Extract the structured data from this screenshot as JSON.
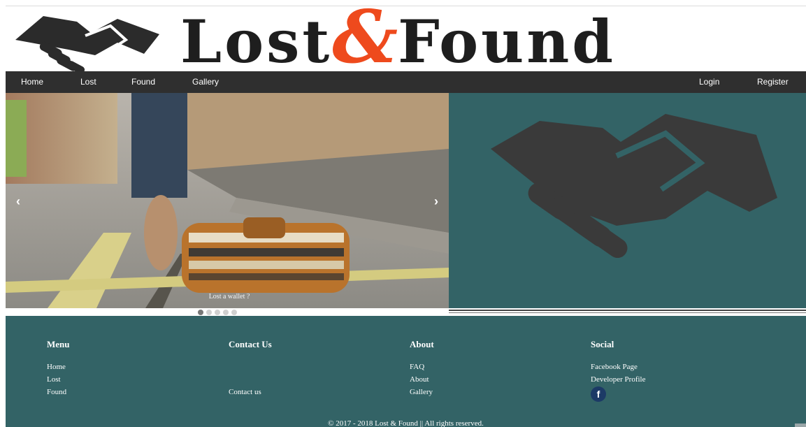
{
  "brand": {
    "word1": "Lost",
    "ampersand": "&",
    "word2": "Found",
    "colors": {
      "dark": "#1e1e1e",
      "accent": "#ee4a1d",
      "teal": "#336366",
      "nav": "#2f2f2f"
    },
    "logo_icon": "handshake-icon"
  },
  "nav": {
    "left": [
      "Home",
      "Lost",
      "Found",
      "Gallery"
    ],
    "right": [
      "Login",
      "Register"
    ]
  },
  "carousel": {
    "prev_symbol": "‹",
    "next_symbol": "›",
    "caption": "Lost a wallet ?",
    "slide_count": 5,
    "active_index": 0
  },
  "footer": {
    "menu": {
      "heading": "Menu",
      "links": [
        "Home",
        "Lost",
        "Found"
      ]
    },
    "contact": {
      "heading": "Contact Us",
      "links": [
        "Contact us"
      ]
    },
    "about": {
      "heading": "About",
      "links": [
        "FAQ",
        "About",
        "Gallery"
      ]
    },
    "social": {
      "heading": "Social",
      "links": [
        "Facebook Page",
        "Developer Profile"
      ],
      "icon_glyph": "f",
      "icon": "facebook-icon"
    },
    "copyright": "© 2017 - 2018 Lost & Found || All rights reserved."
  }
}
